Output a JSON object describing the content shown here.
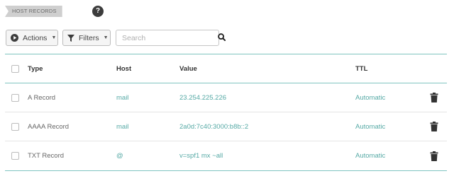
{
  "section": {
    "title": "HOST RECORDS",
    "help_glyph": "?"
  },
  "toolbar": {
    "actions_label": "Actions",
    "filters_label": "Filters",
    "search_placeholder": "Search"
  },
  "table": {
    "columns": [
      "Type",
      "Host",
      "Value",
      "TTL"
    ],
    "rows": [
      {
        "type": "A Record",
        "host": "mail",
        "value": "23.254.225.226",
        "ttl": "Automatic"
      },
      {
        "type": "AAAA Record",
        "host": "mail",
        "value": "2a0d:7c40:3000:b8b::2",
        "ttl": "Automatic"
      },
      {
        "type": "TXT Record",
        "host": "@",
        "value": "v=spf1 mx ~all",
        "ttl": "Automatic"
      }
    ]
  },
  "icons": {
    "help": "question-circle-icon",
    "actions": "play-circle-icon",
    "filters": "funnel-icon",
    "search": "magnifier-icon",
    "delete": "trash-icon",
    "dropdown": "caret-down-icon"
  },
  "colors": {
    "accent": "#55a9a5",
    "rule": "#7fc4c0",
    "tag_bg": "#cfcfcf"
  }
}
